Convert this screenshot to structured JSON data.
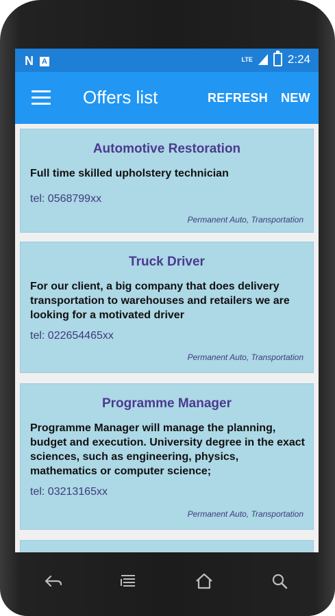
{
  "status_bar": {
    "network_type": "LTE",
    "time": "2:24",
    "notification_icons": [
      "n-icon",
      "a-icon"
    ]
  },
  "app_bar": {
    "title": "Offers list",
    "actions": {
      "refresh": "REFRESH",
      "new": "NEW"
    }
  },
  "offers": [
    {
      "title": "Automotive Restoration",
      "description": "Full time skilled upholstery technician",
      "tel": "tel: 0568799xx",
      "tags": "Permanent Auto, Transportation"
    },
    {
      "title": "Truck Driver",
      "description": "For our client, a big company that does delivery transportation to warehouses and retailers we are looking for a motivated driver",
      "tel": "tel: 022654465xx",
      "tags": "Permanent Auto, Transportation"
    },
    {
      "title": "Programme Manager",
      "description": "Programme Manager will manage the planning, budget and execution. University degree in the exact sciences, such as engineering, physics, mathematics or computer science;",
      "tel": "tel: 03213165xx",
      "tags": "Permanent Auto, Transportation"
    }
  ],
  "colors": {
    "status_bar": "#1e7fd6",
    "app_bar": "#2196f3",
    "card_bg": "#add8e6",
    "card_title": "#4b3a8f"
  },
  "nav_bar": {
    "icons": [
      "back-icon",
      "recents-icon",
      "home-icon",
      "search-icon"
    ]
  }
}
